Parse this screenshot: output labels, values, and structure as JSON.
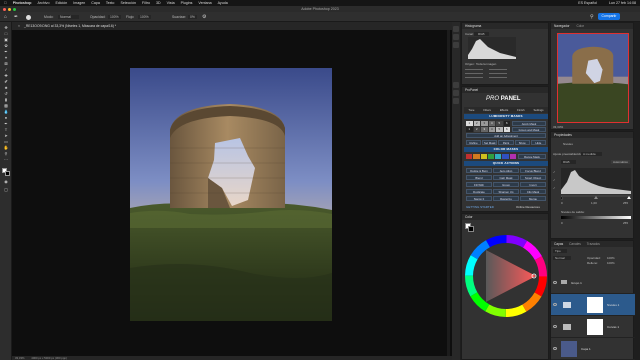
{
  "menubar": {
    "app": "Photoshop",
    "items": [
      "Archivo",
      "Edición",
      "Imagen",
      "Capa",
      "Texto",
      "Selección",
      "Filtro",
      "3D",
      "Vista",
      "Plugins",
      "Ventana",
      "Ayuda"
    ],
    "clock": "Lun 27 feb 14:08",
    "keyboard": "ES Español"
  },
  "window": {
    "title": "Adobe Photoshop 2023"
  },
  "options": {
    "mode_label": "Modo:",
    "mode_value": "Normal",
    "opacity_label": "Opacidad:",
    "opacity_value": "100%",
    "flow_label": "Flujo:",
    "flow_value": "100%",
    "smoothing_label": "Suavizar:",
    "smoothing_value": "0%"
  },
  "share_button": "Compartir",
  "document": {
    "tab": "_RE13OO9.DNG al 33,3% (Niveles 1, Máscara de capa/16) *",
    "zoom": "33,33%",
    "dimensions": "4000 px x 5000 px (300 ppp)"
  },
  "histogram": {
    "title": "Histograma",
    "channel_label": "Canal:",
    "channel_value": "RGB",
    "source_label": "Origen:",
    "source_value": "Toda la imagen"
  },
  "navigator": {
    "tabs": [
      "Navegador",
      "Color"
    ],
    "zoom": "33,33%"
  },
  "propanel": {
    "title": "ProPanel",
    "logo_pro": "PRO",
    "logo_panel": "PANEL",
    "tabs": [
      "Tone",
      "Filters",
      "Effects",
      "Finish",
      "Settings"
    ],
    "luminosity_header": "LUMINOSITY MASKS",
    "lum_numbers": [
      "1",
      "2",
      "3",
      "4",
      "5",
      "6"
    ],
    "lum_buttons": [
      "Apply Mask",
      "Group and Mask",
      "Add an Adjustment"
    ],
    "lum_actions": [
      "Refine",
      "Sel Mask",
      "Paint",
      "Show",
      "Hide"
    ],
    "color_header": "COLOR MASKS",
    "color_actions": [
      "Range Mask"
    ],
    "quick_header": "QUICK ACTIONS",
    "quick_buttons": [
      "Dodge & Burn",
      "Auto Align",
      "Focus Blend",
      "Blend",
      "Calc Mask",
      "Smart Object",
      "Fill With",
      "Group",
      "Invert",
      "Duplicate",
      "Sharpen Up",
      "Clip Mask",
      "Stamp It",
      "Rasterize",
      "Merge"
    ],
    "footer_left": "GETTING STARTED",
    "footer_right": "Online Resources"
  },
  "color_panel": {
    "title": "Color"
  },
  "properties": {
    "title": "Propiedades",
    "subtitle": "Niveles",
    "preset_label": "Ajuste preestablecido:",
    "preset_value": "A medida",
    "channel_label": "RGB",
    "auto_button": "Automático",
    "input_values": [
      "0",
      "1,00",
      "255"
    ],
    "output_label": "Niveles de salida:",
    "output_values": [
      "0",
      "255"
    ]
  },
  "layers": {
    "tabs": [
      "Capas",
      "Canales",
      "Trazados"
    ],
    "filter_label": "Tipo",
    "blend_value": "Normal",
    "opacity_label": "Opacidad:",
    "opacity_value": "100%",
    "fill_label": "Relleno:",
    "fill_value": "100%",
    "items": [
      {
        "name": "Grupo 1"
      },
      {
        "name": "Niveles 1"
      },
      {
        "name": "Curvas 1"
      },
      {
        "name": "Capa 1"
      }
    ]
  },
  "colors": {
    "accent": "#1473e6",
    "sky_top": "#3a4a8a",
    "sky_bottom": "#d8a878",
    "ground": "#3d4a24",
    "ruin": "#9a7e5a"
  }
}
